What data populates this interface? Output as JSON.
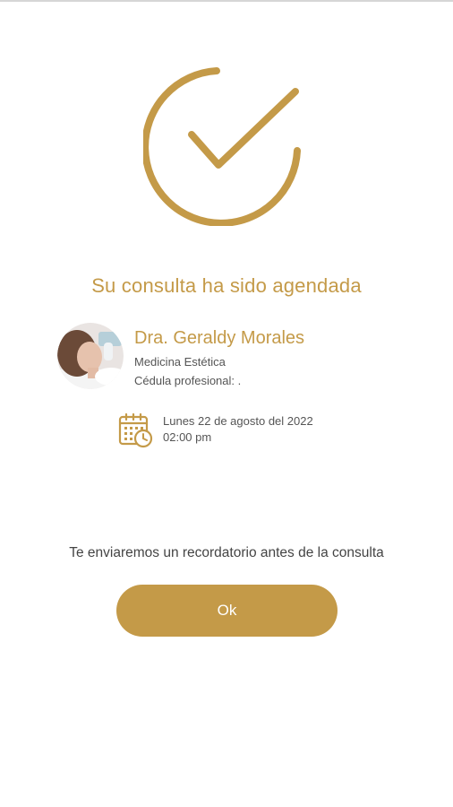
{
  "confirmation": {
    "title": "Su consulta ha sido agendada",
    "success_icon": "check-circle-icon"
  },
  "doctor": {
    "name": "Dra. Geraldy Morales",
    "specialty": "Medicina Estética",
    "license": "Cédula profesional: .",
    "avatar": "doctor-photo"
  },
  "appointment": {
    "date": "Lunes 22 de agosto del 2022",
    "time": "02:00 pm",
    "icon": "calendar-clock-icon"
  },
  "reminder_text": "Te enviaremos un recordatorio antes de la consulta",
  "ok_label": "Ok",
  "colors": {
    "accent": "#c49a48",
    "text": "#555555",
    "background": "#ffffff"
  }
}
